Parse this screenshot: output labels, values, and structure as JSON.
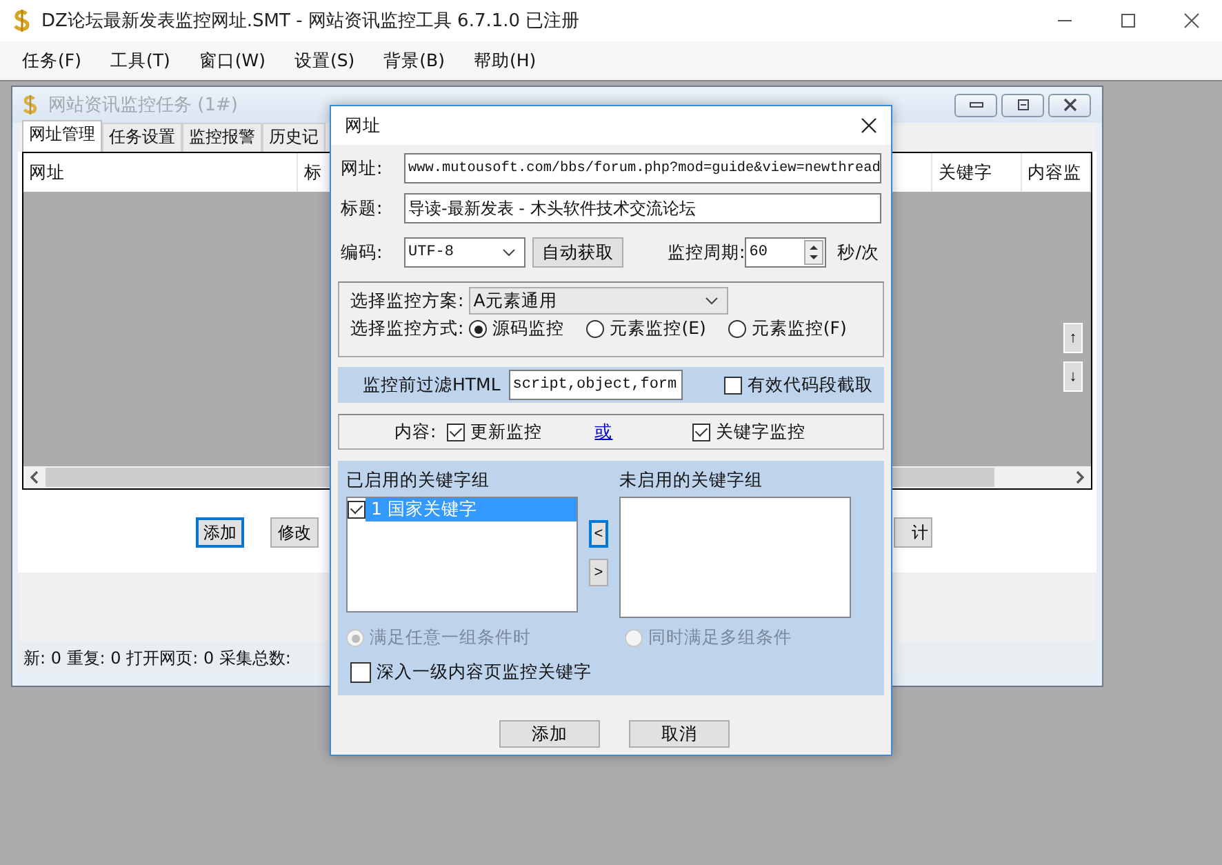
{
  "window": {
    "title": "DZ论坛最新发表监控网址.SMT  - 网站资讯监控工具 6.7.1.0  已注册"
  },
  "menu": [
    "任务(F)",
    "工具(T)",
    "窗口(W)",
    "设置(S)",
    "背景(B)",
    "帮助(H)"
  ],
  "task_window": {
    "title": "网站资讯监控任务 (1#)",
    "tabs": [
      {
        "label": "网址管理",
        "selected": true
      },
      {
        "label": "任务设置",
        "selected": false
      },
      {
        "label": "监控报警",
        "selected": false
      },
      {
        "label": "历史记",
        "selected": false
      }
    ],
    "table": {
      "columns": [
        "网址",
        "标",
        "关键字",
        "内容监"
      ]
    },
    "arrows": [
      "↑",
      "↓"
    ],
    "buttons": [
      "添加",
      "修改",
      "计"
    ],
    "status": "新: 0 重复: 0 打开网页: 0 采集总数:"
  },
  "dialog": {
    "title": "网址",
    "url": {
      "label": "网址:",
      "value": "www.mutousoft.com/bbs/forum.php?mod=guide&view=newthread"
    },
    "page_title": {
      "label": "标题:",
      "value": "导读-最新发表 -  木头软件技术交流论坛"
    },
    "encoding": {
      "label": "编码:",
      "value": "UTF-8"
    },
    "auto_button": "自动获取",
    "period": {
      "label": "监控周期:",
      "value": "60",
      "unit": "秒/次"
    },
    "scheme": {
      "label": "选择监控方案:",
      "value": "A元素通用"
    },
    "mode": {
      "label": "选择监控方式:",
      "options": [
        {
          "label": "源码监控",
          "selected": true
        },
        {
          "label": "元素监控(E)",
          "selected": false
        },
        {
          "label": "元素监控(F)",
          "selected": false
        }
      ]
    },
    "filter": {
      "label": "监控前过滤HTML",
      "value": "script,object,form",
      "checkbox": {
        "label": "有效代码段截取",
        "checked": false
      }
    },
    "content": {
      "label": "内容:",
      "options": [
        {
          "label": "更新监控",
          "checked": true
        },
        {
          "label": "关键字监控",
          "checked": true
        }
      ],
      "link": "或"
    },
    "enabled_groups": {
      "label": "已启用的关键字组",
      "items": [
        {
          "label": "1 国家关键字",
          "checked": true,
          "selected": true
        }
      ]
    },
    "disabled_groups": {
      "label": "未启用的关键字组"
    },
    "move_buttons": [
      "<",
      ">"
    ],
    "match": [
      {
        "label": "满足任意一组条件时",
        "selected": true,
        "disabled": true
      },
      {
        "label": "同时满足多组条件",
        "selected": false,
        "disabled": true
      }
    ],
    "deep": {
      "label": "深入一级内容页监控关键字",
      "checked": false
    },
    "buttons": [
      "添加",
      "取消"
    ]
  }
}
